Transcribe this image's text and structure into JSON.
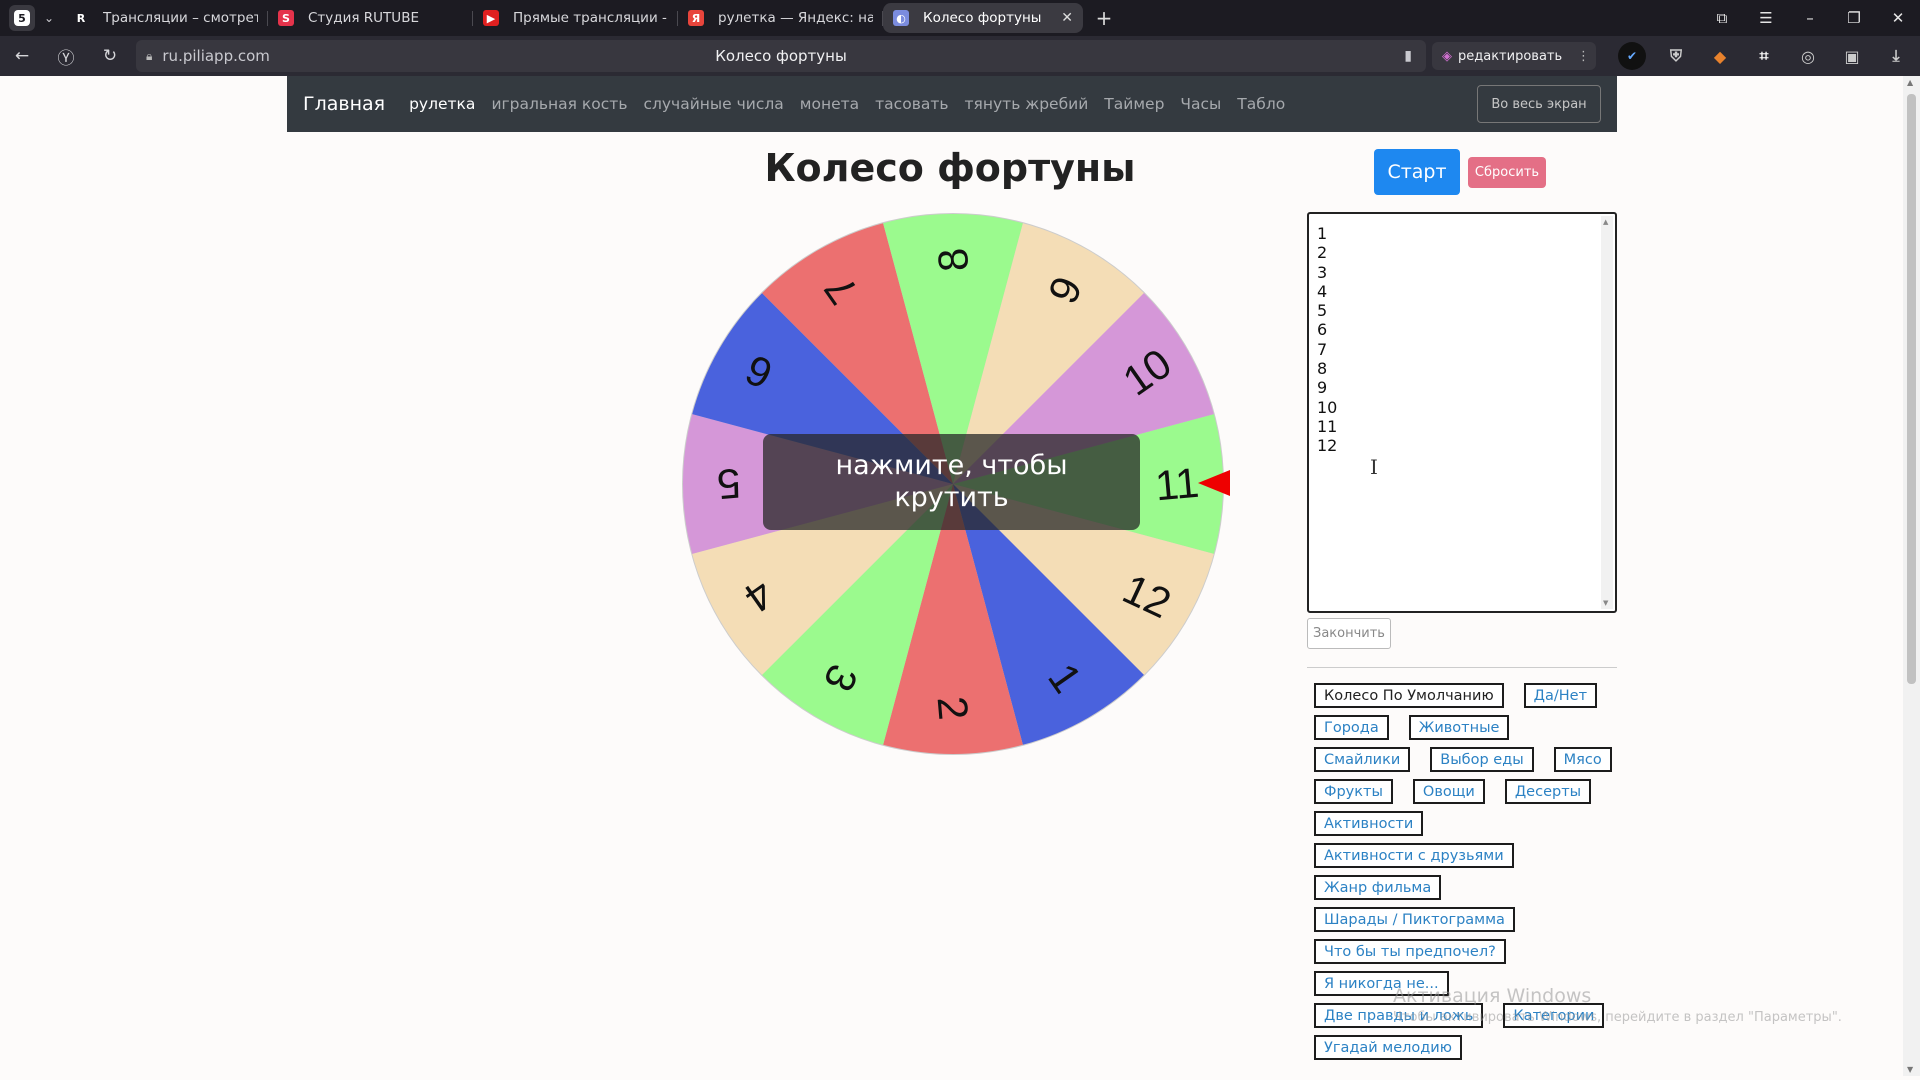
{
  "browser": {
    "tabs": [
      {
        "title": "Трансляции – смотреть в",
        "favicon": "rutube-r-icon",
        "color": "#1c1b22",
        "letter": "R"
      },
      {
        "title": "Студия RUTUBE",
        "favicon": "rutube-studio-icon",
        "color": "#e5334b",
        "letter": "S"
      },
      {
        "title": "Прямые трансляции - You",
        "favicon": "youtube-icon",
        "color": "#e02020",
        "letter": "▶"
      },
      {
        "title": "рулетка — Яндекс: нашло",
        "favicon": "yandex-icon",
        "color": "#e8453c",
        "letter": "Я"
      },
      {
        "title": "Колесо фортуны",
        "favicon": "piliapp-icon",
        "color": "#7b8cde",
        "letter": "◐"
      }
    ],
    "url": "ru.piliapp.com",
    "page_title": "Колесо фортуны",
    "edit_label": "редактировать"
  },
  "nav": {
    "brand": "Главная",
    "links": [
      "рулетка",
      "игральная кость",
      "случайные числа",
      "монета",
      "тасовать",
      "тянуть жребий",
      "Таймер",
      "Часы",
      "Табло"
    ],
    "fullscreen": "Во весь экран"
  },
  "main": {
    "title": "Колесо фортуны",
    "start": "Старт",
    "reset": "Сбросить",
    "overlay": "нажмите, чтобы крутить",
    "entries": [
      "1",
      "2",
      "3",
      "4",
      "5",
      "6",
      "7",
      "8",
      "9",
      "10",
      "11",
      "12"
    ],
    "finish": "Закончить"
  },
  "wheel": {
    "segments": [
      {
        "label": "11",
        "color": "#9bfa8e"
      },
      {
        "label": "12",
        "color": "#f4ddb6"
      },
      {
        "label": "1",
        "color": "#4a62dd"
      },
      {
        "label": "2",
        "color": "#ec7070"
      },
      {
        "label": "3",
        "color": "#9bfa8e"
      },
      {
        "label": "4",
        "color": "#f4ddb6"
      },
      {
        "label": "5",
        "color": "#d597d8"
      },
      {
        "label": "6",
        "color": "#4a62dd"
      },
      {
        "label": "7",
        "color": "#ec7070"
      },
      {
        "label": "8",
        "color": "#9bfa8e"
      },
      {
        "label": "9",
        "color": "#f4ddb6"
      },
      {
        "label": "10",
        "color": "#d597d8"
      }
    ]
  },
  "presets": [
    [
      "Колесо По Умолчанию",
      "Да/Нет"
    ],
    [
      "Города",
      "Животные"
    ],
    [
      "Смайлики",
      "Выбор еды",
      "Мясо"
    ],
    [
      "Фрукты",
      "Овощи",
      "Десерты"
    ],
    [
      "Активности"
    ],
    [
      "Активности с друзьями"
    ],
    [
      "Жанр фильма"
    ],
    [
      "Шарады / Пиктограмма"
    ],
    [
      "Что бы ты предпочел?"
    ],
    [
      "Я никогда не..."
    ],
    [
      "Две правды и ложь",
      "Категории"
    ],
    [
      "Угадай мелодию"
    ]
  ],
  "watermark": {
    "line1": "Активация Windows",
    "line2": "Чтобы активировать Windows, перейдите в раздел \"Параметры\"."
  }
}
